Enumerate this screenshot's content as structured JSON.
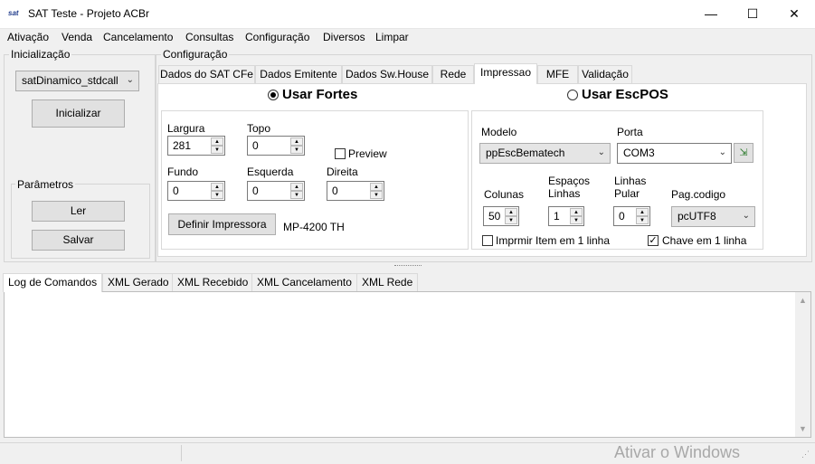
{
  "window": {
    "title": "SAT Teste - Projeto ACBr",
    "icon_text": "sat",
    "minimize": "—",
    "maximize": "☐",
    "close": "✕"
  },
  "menu": [
    "Ativação",
    "Venda",
    "Cancelamento",
    "Consultas",
    "Configuração",
    "Diversos",
    "Limpar"
  ],
  "init": {
    "group_label": "Inicialização",
    "library": "satDinamico_stdcall",
    "init_button": "Inicializar",
    "params_label": "Parâmetros",
    "read_button": "Ler",
    "save_button": "Salvar"
  },
  "config": {
    "group_label": "Configuração",
    "tabs": [
      "Dados do SAT CFe",
      "Dados Emitente",
      "Dados Sw.House",
      "Rede",
      "Impressao",
      "MFE",
      "Validação"
    ],
    "active_tab": "Impressao",
    "radio_fortes": "Usar Fortes",
    "radio_escpos": "Usar EscPOS",
    "fortes": {
      "largura_label": "Largura",
      "largura": "281",
      "topo_label": "Topo",
      "topo": "0",
      "preview_label": "Preview",
      "preview_checked": false,
      "fundo_label": "Fundo",
      "fundo": "0",
      "esquerda_label": "Esquerda",
      "esquerda": "0",
      "direita_label": "Direita",
      "direita": "0",
      "define_button": "Definir Impressora",
      "printer_name": "MP-4200 TH"
    },
    "escpos": {
      "modelo_label": "Modelo",
      "modelo": "ppEscBematech",
      "porta_label": "Porta",
      "porta": "COM3",
      "colunas_label": "Colunas",
      "colunas": "50",
      "espacos_label": "Espaços Linhas",
      "espacos": "1",
      "linhas_label": "Linhas Pular",
      "linhas": "0",
      "pagcodigo_label": "Pag.codigo",
      "pagcodigo": "pcUTF8",
      "item1linha_label": "Imprmir Item em 1 linha",
      "item1linha_checked": false,
      "chave1linha_label": "Chave em 1 linha",
      "chave1linha_checked": true
    }
  },
  "bottom_tabs": [
    "Log de Comandos",
    "XML Gerado",
    "XML Recebido",
    "XML Cancelamento",
    "XML Rede"
  ],
  "watermark": "Ativar o Windows"
}
